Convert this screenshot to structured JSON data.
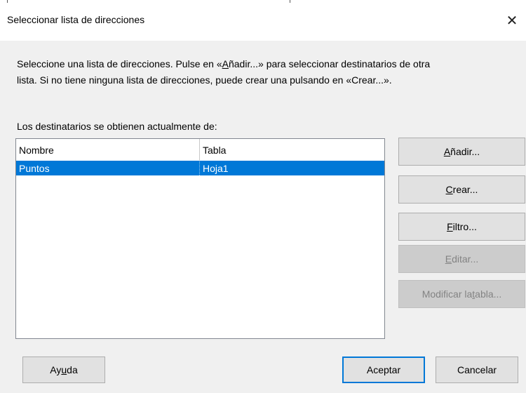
{
  "dialog": {
    "title": "Seleccionar lista de direcciones",
    "close_symbol": "✕"
  },
  "intro": {
    "line1_pre": "Seleccione una lista de direcciones. Pulse en «",
    "line1_ul": "A",
    "line1_mid": "ñadir...» para seleccionar destinatarios de otra",
    "line2": "lista. Si no tiene ninguna lista de direcciones, puede crear una pulsando en «Crear...»."
  },
  "source_label": "Los destinatarios se obtienen actualmente de:",
  "list": {
    "columns": [
      "Nombre",
      "Tabla"
    ],
    "rows": [
      {
        "nombre": "Puntos",
        "tabla": "Hoja1",
        "selected": true
      }
    ]
  },
  "buttons": {
    "add": {
      "ul": "A",
      "rest": "ñadir..."
    },
    "create": {
      "ul": "C",
      "rest": "rear..."
    },
    "filter": {
      "ul": "F",
      "rest": "iltro..."
    },
    "edit": {
      "ul": "E",
      "rest": "ditar..."
    },
    "modify": {
      "pre": "Modificar la ",
      "ul": "t",
      "rest": "abla..."
    },
    "help": {
      "pre": "Ay",
      "ul": "u",
      "rest": "da"
    },
    "ok": "Aceptar",
    "cancel": "Cancelar"
  },
  "colors": {
    "selection": "#0078d7",
    "dialog_bg": "#f0f0f0",
    "default_button_border": "#0078d7"
  }
}
